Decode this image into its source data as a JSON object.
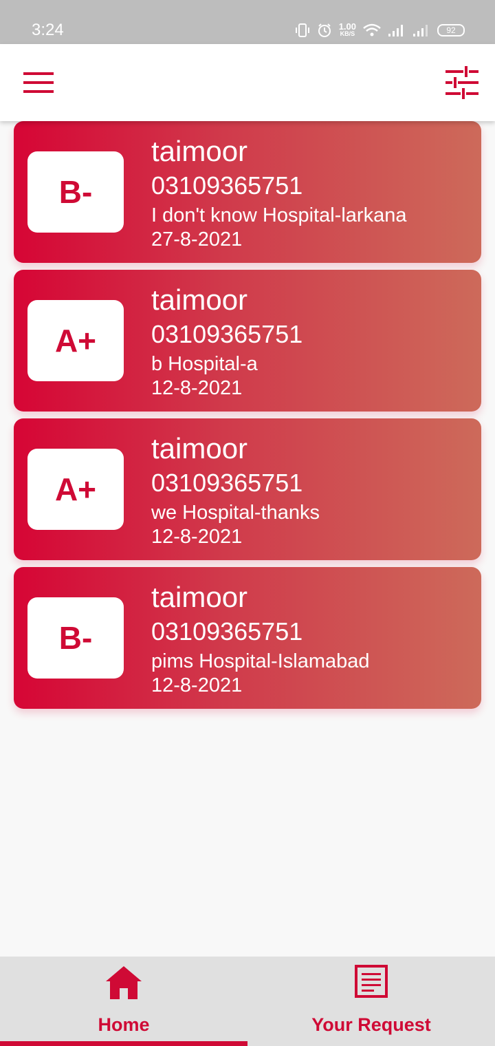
{
  "status_bar": {
    "time": "3:24",
    "net_speed_value": "1.00",
    "net_speed_unit": "KB/S",
    "battery": "92",
    "icons": [
      "vibrate-icon",
      "alarm-icon",
      "wifi-icon",
      "signal-icon",
      "signal-icon-2",
      "battery-icon"
    ]
  },
  "app_bar": {
    "left_icon": "menu-icon",
    "right_icon": "tune-filter-icon"
  },
  "colors": {
    "accent": "#cf0a35",
    "card_gradient_start": "#d60535",
    "card_gradient_end": "#cd6a5a",
    "nav_background": "#e0e0e0",
    "page_background": "#f8f8f8"
  },
  "requests": [
    {
      "blood_group": "B-",
      "name": "taimoor",
      "phone": "03109365751",
      "hospital": "I don't know Hospital-larkana",
      "date": "27-8-2021"
    },
    {
      "blood_group": "A+",
      "name": "taimoor",
      "phone": "03109365751",
      "hospital": "b Hospital-a",
      "date": "12-8-2021"
    },
    {
      "blood_group": "A+",
      "name": "taimoor",
      "phone": "03109365751",
      "hospital": "we Hospital-thanks",
      "date": "12-8-2021"
    },
    {
      "blood_group": "B-",
      "name": "taimoor",
      "phone": "03109365751",
      "hospital": "pims Hospital-Islamabad",
      "date": "12-8-2021"
    }
  ],
  "bottom_nav": {
    "items": [
      {
        "label": "Home",
        "icon": "home-icon",
        "selected": true
      },
      {
        "label": "Your Request",
        "icon": "article-icon",
        "selected": false
      }
    ]
  }
}
